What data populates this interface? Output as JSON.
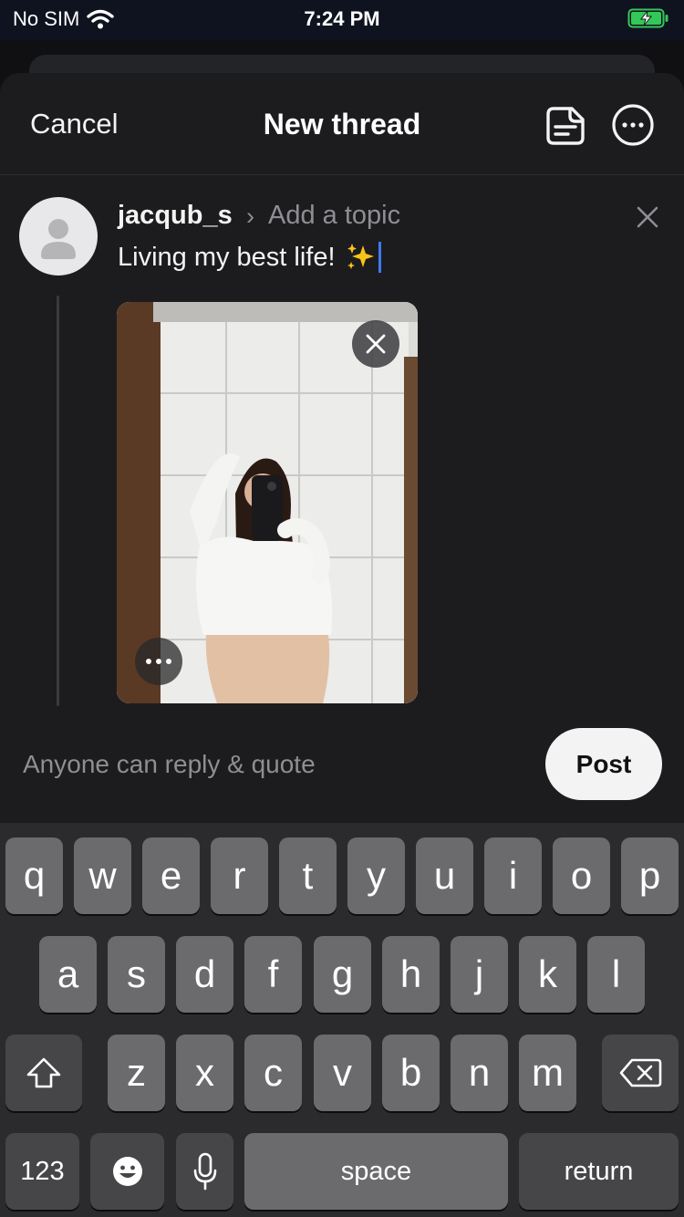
{
  "status_bar": {
    "carrier": "No SIM",
    "time": "7:24 PM"
  },
  "nav": {
    "cancel_label": "Cancel",
    "title": "New thread"
  },
  "composer": {
    "username": "jacqub_s",
    "topic_placeholder": "Add a topic",
    "text": "Living my best life!"
  },
  "footer": {
    "reply_setting": "Anyone can reply & quote",
    "post_label": "Post"
  },
  "keyboard": {
    "row1": [
      "q",
      "w",
      "e",
      "r",
      "t",
      "y",
      "u",
      "i",
      "o",
      "p"
    ],
    "row2": [
      "a",
      "s",
      "d",
      "f",
      "g",
      "h",
      "j",
      "k",
      "l"
    ],
    "row3": [
      "z",
      "x",
      "c",
      "v",
      "b",
      "n",
      "m"
    ],
    "numbers_label": "123",
    "space_label": "space",
    "return_label": "return"
  },
  "colors": {
    "background": "#101013",
    "sheet": "#1c1c1e",
    "secondary_text": "#8e8e93",
    "caret": "#3d7bf7",
    "battery": "#34c759"
  }
}
